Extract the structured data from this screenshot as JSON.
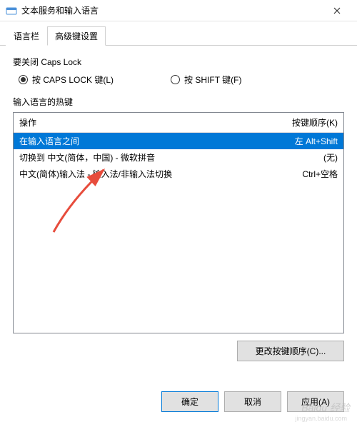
{
  "window": {
    "title": "文本服务和输入语言"
  },
  "tabs": {
    "lang": "语言栏",
    "adv": "高级键设置"
  },
  "capslock": {
    "title": "要关闭 Caps Lock",
    "opt1": "按 CAPS LOCK 键(L)",
    "opt2": "按 SHIFT 键(F)"
  },
  "hotkeys": {
    "title": "输入语言的热键",
    "col_action": "操作",
    "col_seq": "按键顺序(K)",
    "rows": [
      {
        "action": "在输入语言之间",
        "seq": "左 Alt+Shift"
      },
      {
        "action": "切换到 中文(简体，中国) - 微软拼音",
        "seq": "(无)"
      },
      {
        "action": "中文(简体)输入法 - 输入法/非输入法切换",
        "seq": "Ctrl+空格"
      }
    ],
    "change_btn": "更改按键顺序(C)..."
  },
  "buttons": {
    "ok": "确定",
    "cancel": "取消",
    "apply": "应用(A)"
  },
  "watermark": {
    "main": "Baidu 经验",
    "sub": "jingyan.baidu.com"
  }
}
